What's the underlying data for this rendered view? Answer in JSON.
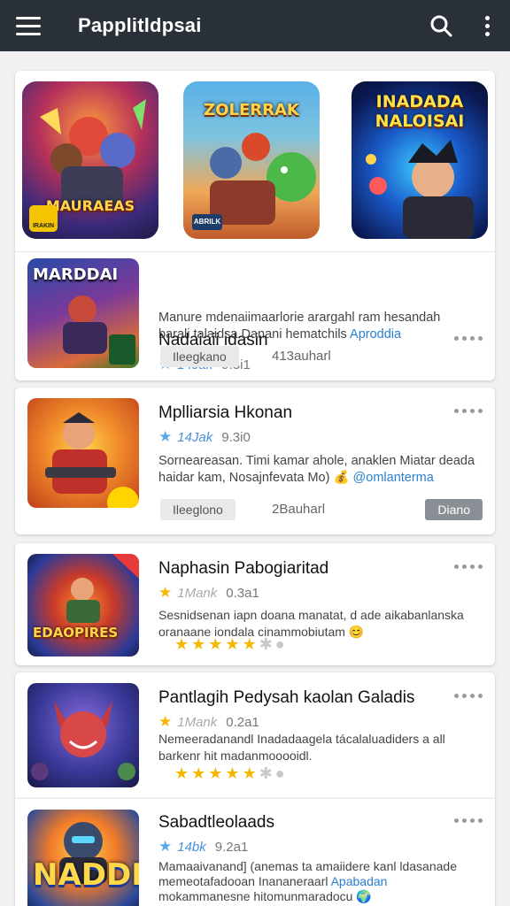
{
  "app_bar": {
    "title": "Papplitldpsai",
    "menu_icon": "hamburger-menu-icon",
    "search_icon": "search-icon",
    "more_icon": "more-vertical-icon",
    "background": "#2a3038"
  },
  "featured": [
    {
      "title": "MAURAEAS",
      "badge": "IRAKIN"
    },
    {
      "title": "ZOLERRAK",
      "badge": "ABRILK"
    },
    {
      "title": "INADADA NALOISAI"
    }
  ],
  "apps": [
    {
      "thumb_title": "MARDDAI",
      "name": "Nadaiaii idasin",
      "rating": "14Jak",
      "size": "9.3i1",
      "desc_line1": "Manure mdenaiimaarlorie arargahl ram hesandah",
      "desc_line2": "barali talaidsa Danani hematchils",
      "desc_link": "Aproddia",
      "chip": "Ileegkano",
      "count": "413auharl"
    },
    {
      "thumb_title": "",
      "name": "Mplliarsia Hkonan",
      "rating": "14Jak",
      "size": "9.3i0",
      "desc_line1": "Sorneareasan. Timi kamar ahole, anaklen Miatar deada",
      "desc_line2": "haidar kam, Nosajnfevata Mo) 💰",
      "desc_link": "@omlanterma",
      "chip": "Ileeglono",
      "count": "2Bauharl",
      "action": "Diano"
    },
    {
      "thumb_title": "EDAOPIRES",
      "name": "Naphasin Pabogiaritad",
      "rating": "1Mank",
      "size": "0.3a1",
      "desc_line1": "Sesnidsenan iapn doana manatat, d ade aikabanlanska",
      "desc_line2": "oranaane iondala cinammobiutam 😊",
      "stars": 4.5
    },
    {
      "thumb_title": "",
      "name": "Pantlagih Pedysah kaolan Galadis",
      "rating": "1Mank",
      "size": "0.2a1",
      "desc_line1": "Nemeeradanandl Inadadaagela tácalaluadiders a all",
      "desc_line2": "barkenr hit madanmooooidl.",
      "stars": 4.5
    },
    {
      "thumb_title": "NADDI",
      "name": "Sabadtleolaads",
      "rating": "14bk",
      "size": "9.2a1",
      "desc_line1": "Mamaaivanand] (anemas ta amaiidere kanl ldasanade",
      "desc_line2": "memeotafadooan Inananeraarl",
      "desc_link": "Apabadan",
      "desc_line3": "mokammanesne hitomunmaradocu 🌍"
    }
  ],
  "colors": {
    "accent_blue": "#4a90d9",
    "star_gold": "#f5b800",
    "star_blue": "#5aa9e6"
  }
}
